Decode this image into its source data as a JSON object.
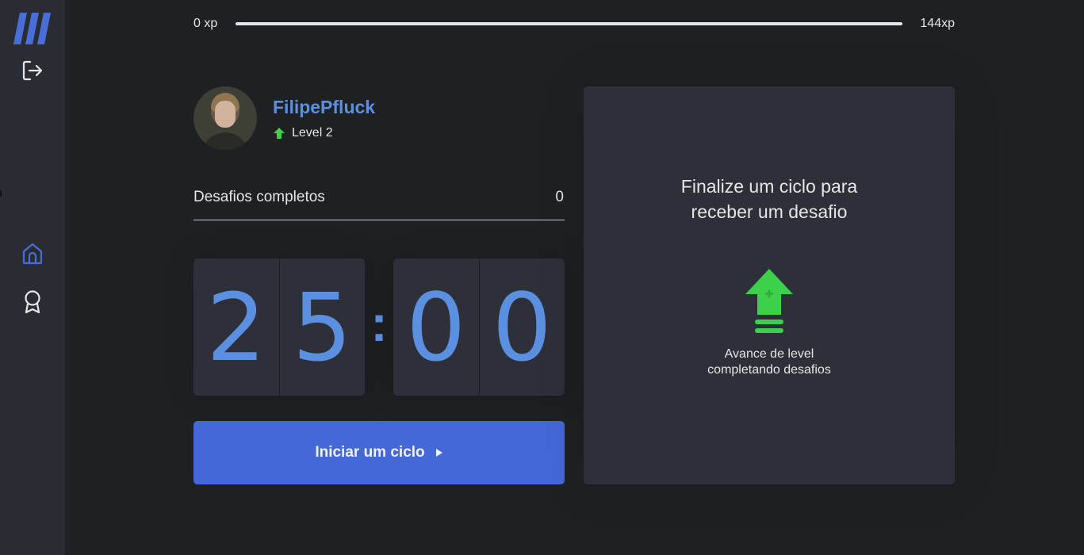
{
  "sidebar": {
    "logo": "moveit-logo",
    "logout_icon": "logout-icon",
    "nav": [
      {
        "name": "home",
        "icon": "home-icon",
        "active": true
      },
      {
        "name": "leaderboard",
        "icon": "award-icon",
        "active": false
      }
    ]
  },
  "experience": {
    "min_label": "0 xp",
    "max_label": "144xp",
    "progress_fraction": 1.0
  },
  "profile": {
    "name": "FilipePfluck",
    "level_label": "Level 2",
    "level_icon": "level-up-arrow-icon"
  },
  "completed_challenges": {
    "label": "Desafios completos",
    "count": "0"
  },
  "countdown": {
    "minute_left": "2",
    "minute_right": "5",
    "separator": ":",
    "second_left": "0",
    "second_right": "0"
  },
  "start_button": {
    "label": "Iniciar um ciclo",
    "icon": "play-icon"
  },
  "challenge_box": {
    "title": "Finalize um ciclo para receber um desafio",
    "icon": "level-up-icon",
    "hint_line1": "Avance de level",
    "hint_line2": "completando desafios"
  },
  "colors": {
    "background": "#1f2024",
    "sidebar": "#2a2c33",
    "card": "#2d3039",
    "accent_blue": "#5b8fe0",
    "button_blue": "#4468d8",
    "level_green": "#3dd04a"
  }
}
